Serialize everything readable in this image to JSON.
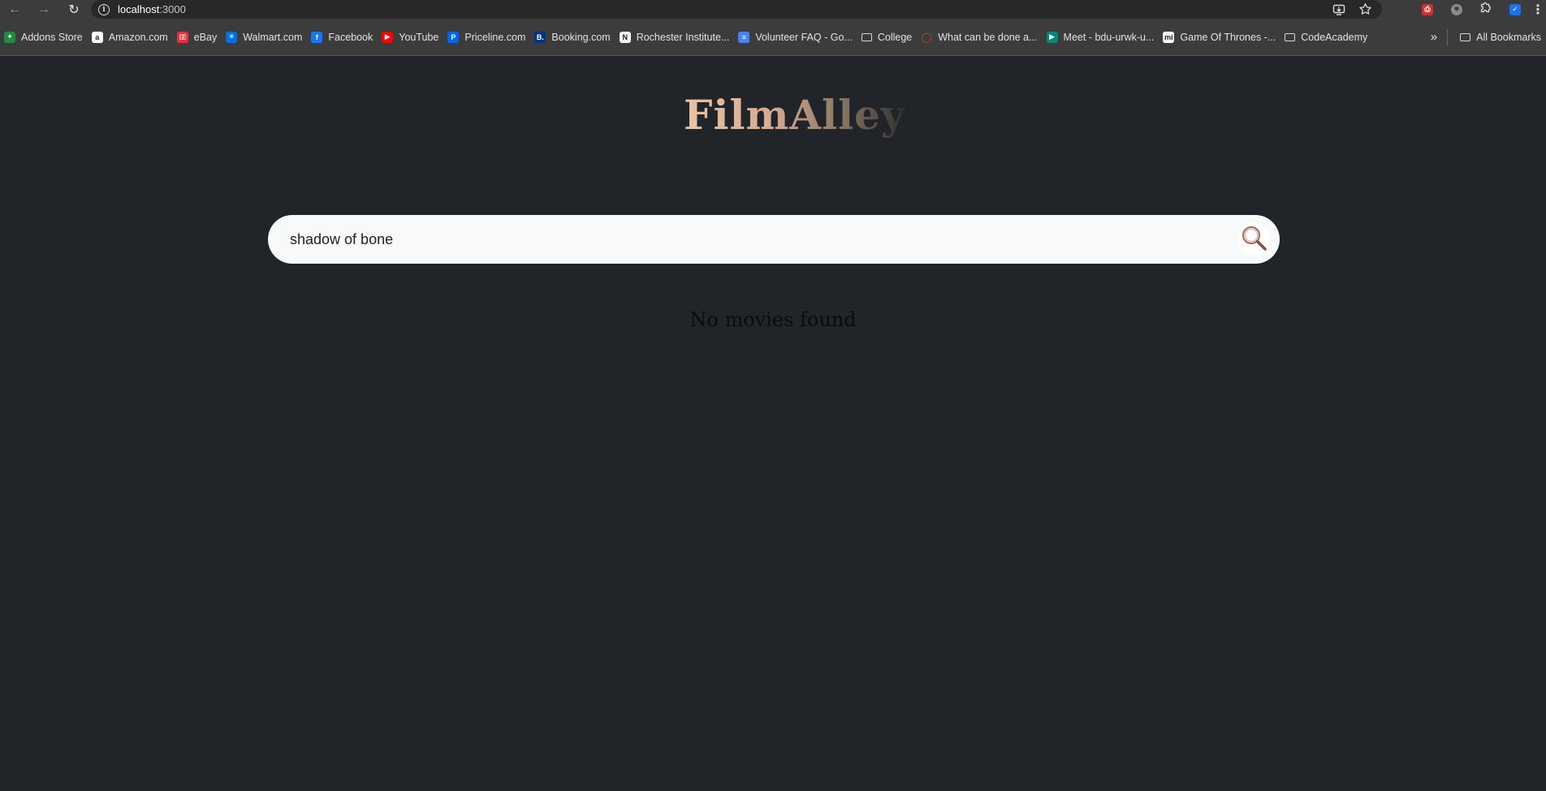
{
  "browser": {
    "url_host": "localhost",
    "url_port": ":3000",
    "bookmarks": [
      {
        "label": "Addons Store",
        "icon": "addons-icon",
        "color": "#1e8e3e"
      },
      {
        "label": "Amazon.com",
        "icon": "amazon-icon",
        "color": "#ffffff"
      },
      {
        "label": "eBay",
        "icon": "ebay-icon",
        "color": "#e53238"
      },
      {
        "label": "Walmart.com",
        "icon": "walmart-icon",
        "color": "#0071dc"
      },
      {
        "label": "Facebook",
        "icon": "facebook-icon",
        "color": "#1877f2"
      },
      {
        "label": "YouTube",
        "icon": "youtube-icon",
        "color": "#ff0000"
      },
      {
        "label": "Priceline.com",
        "icon": "priceline-icon",
        "color": "#0068ef"
      },
      {
        "label": "Booking.com",
        "icon": "booking-icon",
        "color": "#003580"
      },
      {
        "label": "Rochester Institute...",
        "icon": "rit-icon",
        "color": "#f2f2f2"
      },
      {
        "label": "Volunteer FAQ - Go...",
        "icon": "google-docs-icon",
        "color": "#4285f4"
      },
      {
        "label": "College",
        "icon": "folder-icon",
        "color": ""
      },
      {
        "label": "What can be done a...",
        "icon": "speech-bubble-icon",
        "color": "#e53935"
      },
      {
        "label": "Meet - bdu-urwk-u...",
        "icon": "google-meet-icon",
        "color": "#00897b"
      },
      {
        "label": "Game Of Thrones -...",
        "icon": "mi-icon",
        "color": "#ffffff"
      },
      {
        "label": "CodeAcademy",
        "icon": "folder-icon",
        "color": ""
      }
    ],
    "all_bookmarks_label": "All Bookmarks"
  },
  "app": {
    "logo": "FilmAlley",
    "search_value": "shadow of bone",
    "empty_message": "No movies found"
  },
  "colors": {
    "background": "#212529",
    "search_bg": "#f8f9fa",
    "logo_accent": "#e9c3a6",
    "magnifier": "#b06a5c"
  }
}
